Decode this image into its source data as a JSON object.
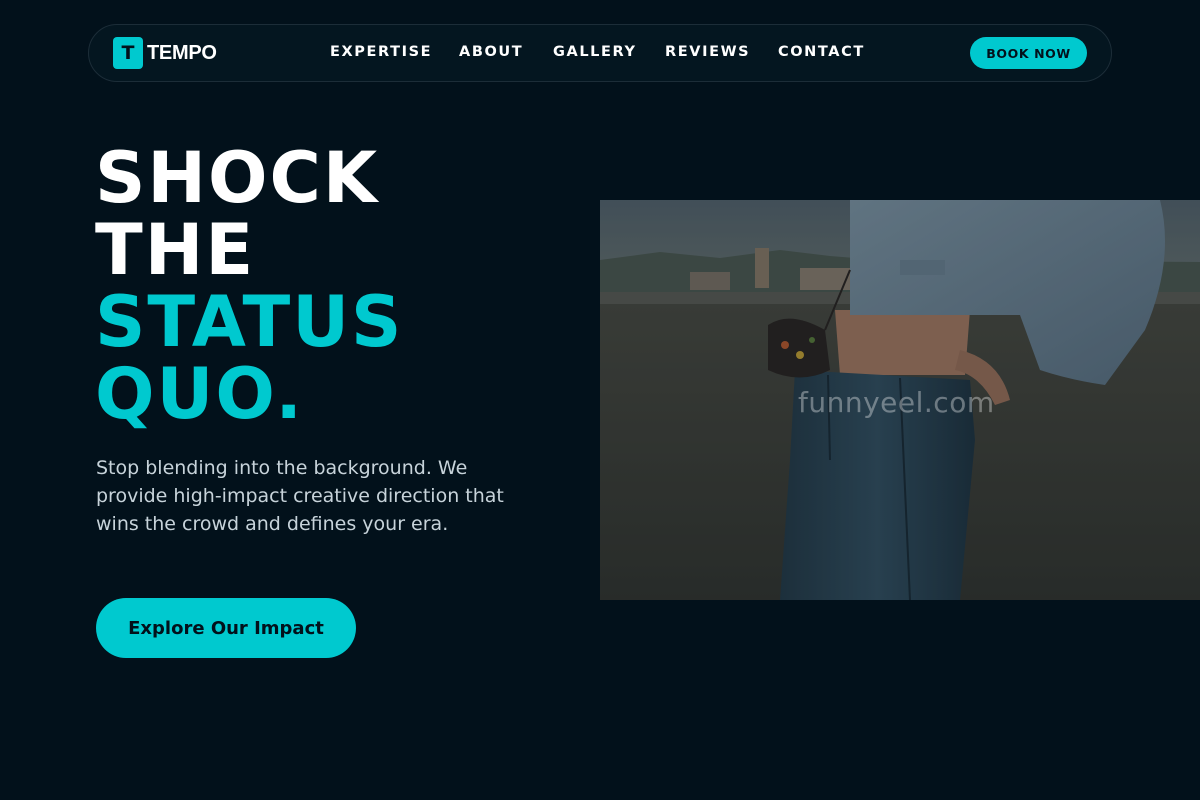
{
  "brand": {
    "logo_letter": "T",
    "name": "TEMPO"
  },
  "nav": {
    "links": [
      "EXPERTISE",
      "ABOUT",
      "GALLERY",
      "REVIEWS",
      "CONTACT"
    ],
    "cta_label": "BOOK NOW"
  },
  "hero": {
    "headline_lines": [
      "SHOCK",
      "THE",
      "STATUS",
      "QUO."
    ],
    "subtext": "Stop blending into the background. We provide high-impact creative direction that wins the crowd and defines your era.",
    "cta_label": "Explore Our Impact",
    "image_watermark": "funnyeel.com"
  },
  "colors": {
    "background": "#02111b",
    "accent": "#00c9cf",
    "text": "#ffffff",
    "muted_text": "#c7d3da"
  }
}
